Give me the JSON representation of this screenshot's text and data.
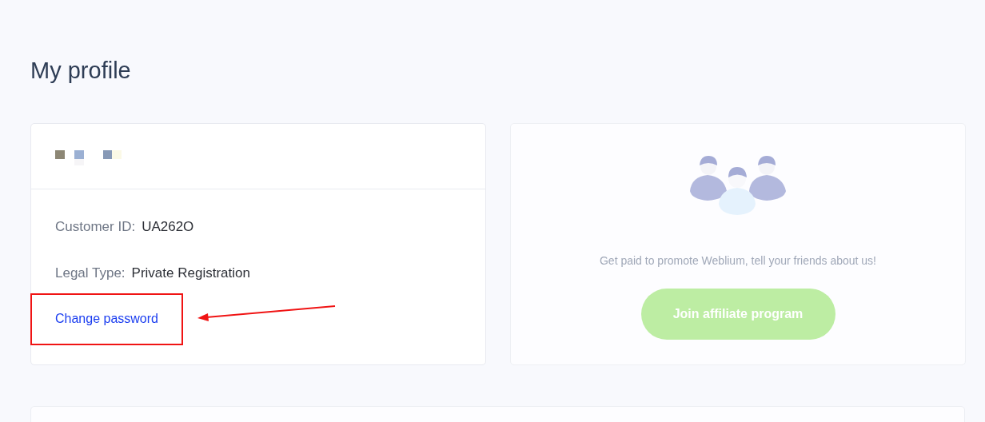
{
  "page": {
    "title": "My profile"
  },
  "profile": {
    "fields": [
      {
        "label": "Customer ID:",
        "value": "UA262O"
      },
      {
        "label": "Legal Type:",
        "value": "Private Registration"
      }
    ],
    "link": "Change password"
  },
  "affiliate": {
    "text": "Get paid to promote Weblium, tell your friends about us!",
    "button": "Join affiliate program"
  }
}
